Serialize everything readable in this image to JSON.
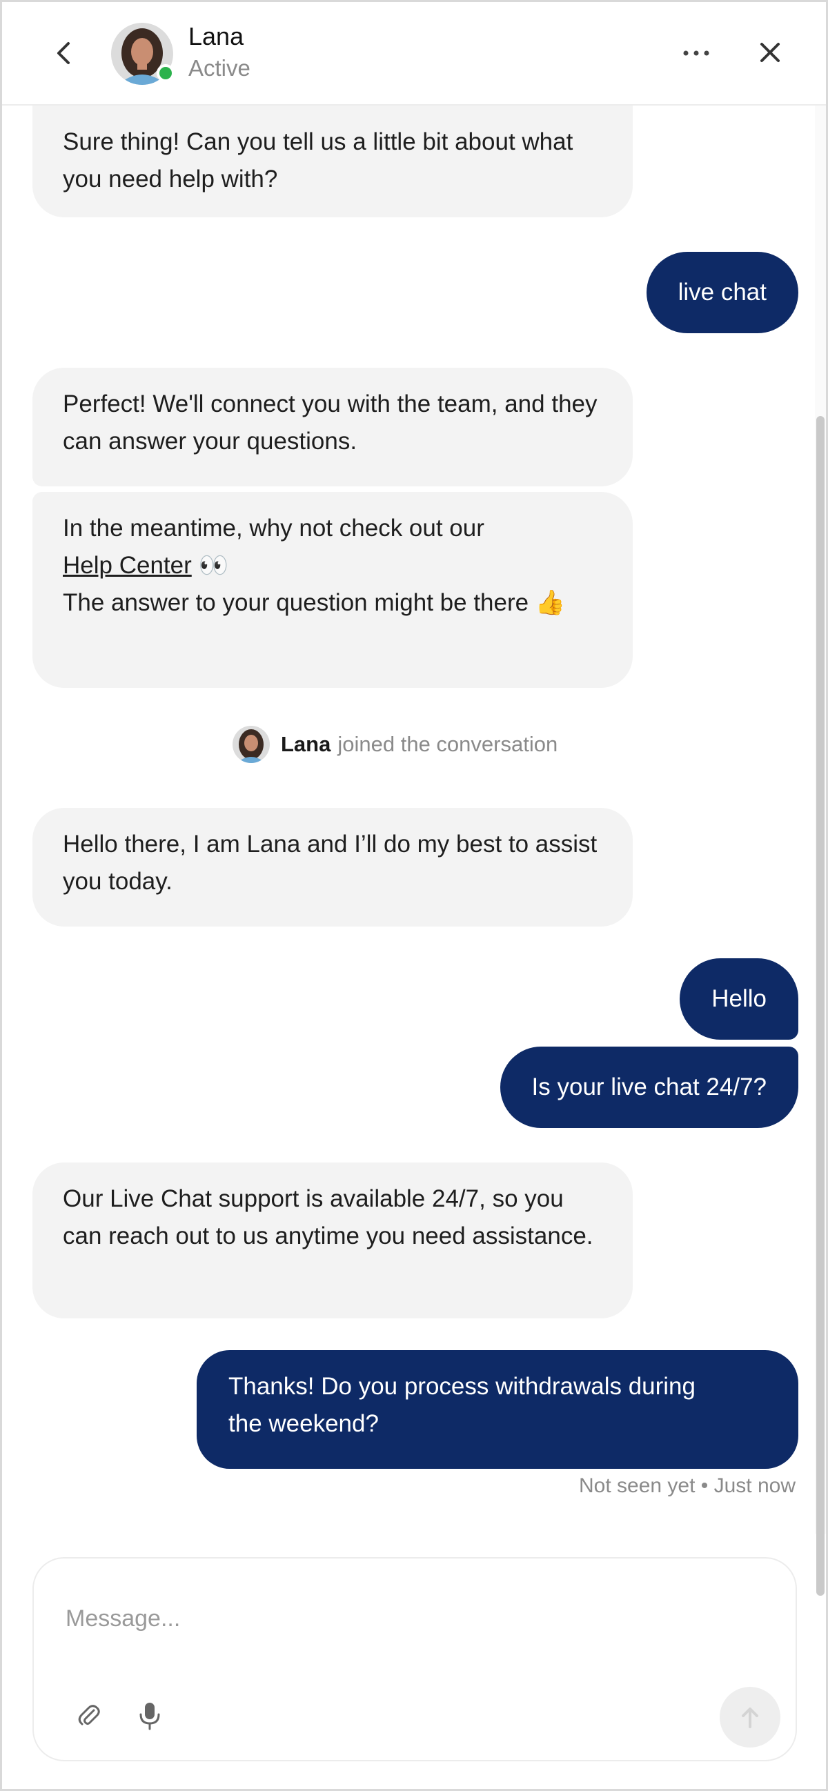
{
  "header": {
    "agent_name": "Lana",
    "agent_status": "Active",
    "status_color": "#2bb24c",
    "back_icon": "chevron-left-icon",
    "more_icon": "more-horizontal-icon",
    "close_icon": "close-icon"
  },
  "messages": [
    {
      "from": "agent",
      "text": "Sure thing! Can you tell us a little bit about what you need help with?"
    },
    {
      "from": "user",
      "text": "live chat"
    },
    {
      "from": "agent",
      "text": "Perfect! We'll connect you with the team, and they can answer your questions."
    },
    {
      "from": "agent",
      "text_before_link": "In the meantime, why not check out our",
      "link_text": "Help Center",
      "emoji_eyes": "👀",
      "text_after_link": "The answer to your question might be there",
      "emoji_thumbs": "👍"
    },
    {
      "from": "agent",
      "text": "Hello there, I am Lana and I’ll do my best to assist you today."
    },
    {
      "from": "user",
      "text": "Hello"
    },
    {
      "from": "user",
      "text": "Is your live chat 24/7?"
    },
    {
      "from": "agent",
      "text": "Our Live Chat support is available 24/7, so you can reach out to us anytime you need assistance."
    },
    {
      "from": "user",
      "text": "Thanks! Do you process withdrawals during the weekend?"
    }
  ],
  "system_event": {
    "name": "Lana",
    "text": "joined the conversation"
  },
  "receipt": "Not seen yet • Just now",
  "composer": {
    "placeholder": "Message...",
    "value": "",
    "attach_icon": "paperclip-icon",
    "mic_icon": "microphone-icon",
    "send_icon": "arrow-up-icon"
  },
  "colors": {
    "user_bubble": "#0e2a66",
    "agent_bubble": "#f3f3f3",
    "online_dot": "#2bb24c"
  }
}
